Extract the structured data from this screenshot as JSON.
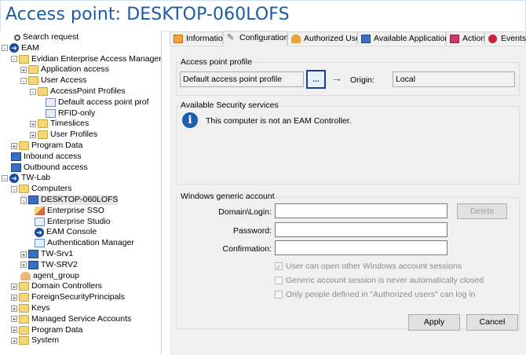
{
  "window": {
    "title": "Access point: DESKTOP-060LOFS"
  },
  "tree": {
    "items": [
      {
        "label": "Search request",
        "icon": "search-icon"
      },
      {
        "label": "EAM",
        "icon": "eam-arrow-icon",
        "expander": "-"
      },
      {
        "label": "Evidian Enterprise Access Managem",
        "icon": "folder-icon",
        "expander": "-"
      },
      {
        "label": "Application access",
        "icon": "folder-icon",
        "expander": "+"
      },
      {
        "label": "User Access",
        "icon": "folder-icon",
        "expander": "-"
      },
      {
        "label": "AccessPoint Profiles",
        "icon": "folder-icon",
        "expander": "-"
      },
      {
        "label": "Default access point prof",
        "icon": "profile-icon"
      },
      {
        "label": "RFID-only",
        "icon": "profile-icon"
      },
      {
        "label": "Timeslices",
        "icon": "folder-icon",
        "expander": "+"
      },
      {
        "label": "User Profiles",
        "icon": "folder-icon",
        "expander": "+"
      },
      {
        "label": "Program Data",
        "icon": "folder-icon",
        "expander": "+"
      },
      {
        "label": "Inbound access",
        "icon": "access-icon"
      },
      {
        "label": "Outbound access",
        "icon": "access-icon"
      },
      {
        "label": "TW-Lab",
        "icon": "eam-arrow-icon",
        "expander": "-"
      },
      {
        "label": "Computers",
        "icon": "folder-icon",
        "expander": "-"
      },
      {
        "label": "DESKTOP-060LOFS",
        "icon": "computer-icon",
        "expander": "-"
      },
      {
        "label": "Enterprise SSO",
        "icon": "sso-icon"
      },
      {
        "label": "Enterprise Studio",
        "icon": "studio-icon"
      },
      {
        "label": "EAM Console",
        "icon": "eam-arrow-icon"
      },
      {
        "label": "Authentication Manager",
        "icon": "auth-manager-icon"
      },
      {
        "label": "TW-Srv1",
        "icon": "computer-icon",
        "expander": "+"
      },
      {
        "label": "TW-SRV2",
        "icon": "computer-icon",
        "expander": "+"
      },
      {
        "label": "agent_group",
        "icon": "group-icon"
      },
      {
        "label": "Domain Controllers",
        "icon": "folder-icon",
        "expander": "+"
      },
      {
        "label": "ForeignSecurityPrincipals",
        "icon": "folder-icon",
        "expander": "+"
      },
      {
        "label": "Keys",
        "icon": "folder-icon",
        "expander": "+"
      },
      {
        "label": "Managed Service Accounts",
        "icon": "folder-icon",
        "expander": "+"
      },
      {
        "label": "Program Data",
        "icon": "folder-icon",
        "expander": "+"
      },
      {
        "label": "System",
        "icon": "folder-icon",
        "expander": "+"
      }
    ]
  },
  "tabs": [
    {
      "label": "Information",
      "icon": "information-tab-icon"
    },
    {
      "label": "Configuration",
      "icon": "configuration-tab-icon",
      "active": true
    },
    {
      "label": "Authorized Users",
      "icon": "authorized-users-tab-icon"
    },
    {
      "label": "Available Applications",
      "icon": "applications-tab-icon"
    },
    {
      "label": "Actions",
      "icon": "actions-tab-icon"
    },
    {
      "label": "Events",
      "icon": "events-tab-icon"
    }
  ],
  "profile": {
    "group_label": "Access point profile",
    "value": "Default access point profile",
    "browse_label": "...",
    "go_label": "→",
    "origin_label": "Origin:",
    "origin_value": "Local"
  },
  "security": {
    "group_label": "Available Security services",
    "message": "This computer is not an EAM Controller."
  },
  "account": {
    "group_label": "Windows generic account",
    "domain_label": "Domain\\Login:",
    "password_label": "Password:",
    "confirmation_label": "Confirmation:",
    "domain_value": "",
    "password_value": "",
    "confirmation_value": "",
    "delete_label": "Delete",
    "check1": "User can open other Windows account sessions",
    "check2": "Generic account session is never automatically closed",
    "check3": "Only people defined in \"Authorized users\" can log in"
  },
  "buttons": {
    "apply": "Apply",
    "cancel": "Cancel"
  },
  "colors": {
    "title": "#1b5aa6",
    "highlight_border": "#1a3c9c",
    "accent": "#1c5fb1"
  }
}
